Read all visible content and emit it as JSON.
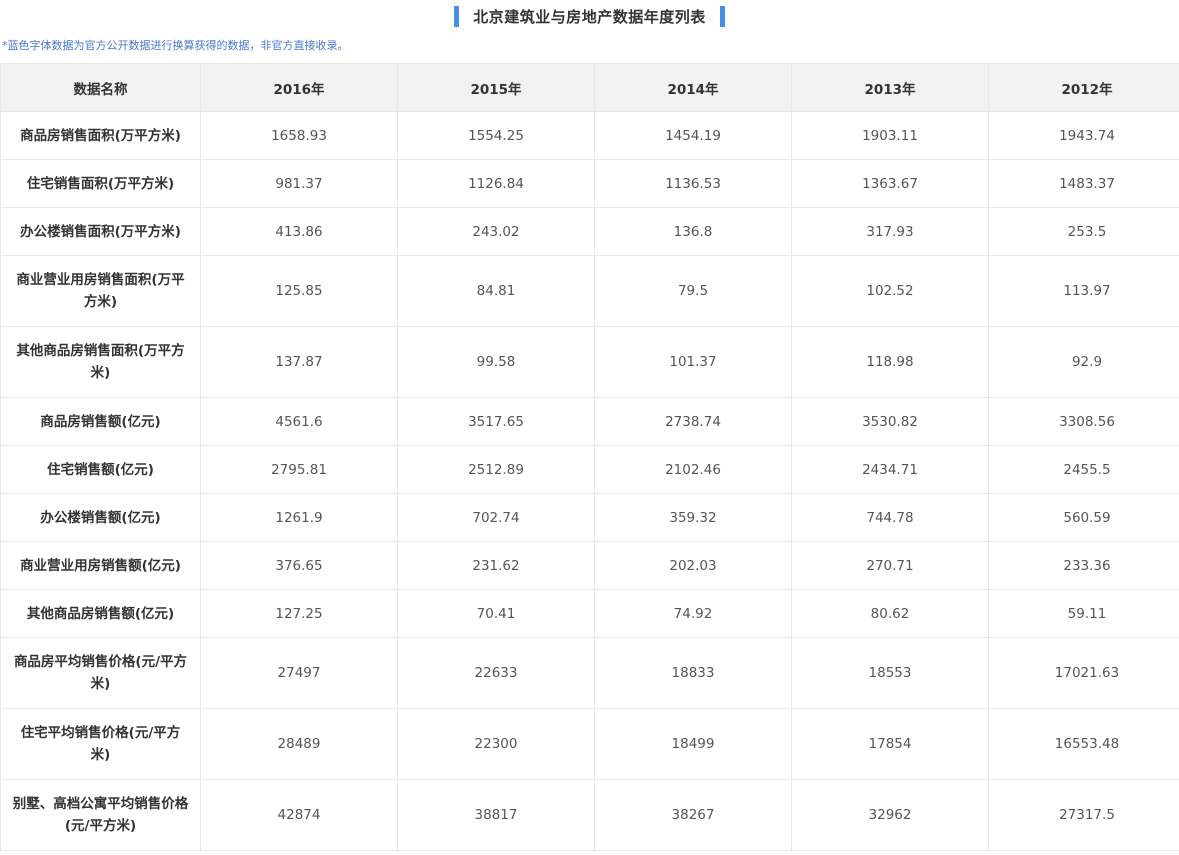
{
  "title": "北京建筑业与房地产数据年度列表",
  "note": "*蓝色字体数据为官方公开数据进行换算获得的数据，非官方直接收录。",
  "table": {
    "headers": [
      "数据名称",
      "2016年",
      "2015年",
      "2014年",
      "2013年",
      "2012年"
    ],
    "rows": [
      {
        "name": "商品房销售面积(万平方米)",
        "values": [
          "1658.93",
          "1554.25",
          "1454.19",
          "1903.11",
          "1943.74"
        ]
      },
      {
        "name": "住宅销售面积(万平方米)",
        "values": [
          "981.37",
          "1126.84",
          "1136.53",
          "1363.67",
          "1483.37"
        ]
      },
      {
        "name": "办公楼销售面积(万平方米)",
        "values": [
          "413.86",
          "243.02",
          "136.8",
          "317.93",
          "253.5"
        ]
      },
      {
        "name": "商业营业用房销售面积(万平方米)",
        "values": [
          "125.85",
          "84.81",
          "79.5",
          "102.52",
          "113.97"
        ]
      },
      {
        "name": "其他商品房销售面积(万平方米)",
        "values": [
          "137.87",
          "99.58",
          "101.37",
          "118.98",
          "92.9"
        ]
      },
      {
        "name": "商品房销售额(亿元)",
        "values": [
          "4561.6",
          "3517.65",
          "2738.74",
          "3530.82",
          "3308.56"
        ]
      },
      {
        "name": "住宅销售额(亿元)",
        "values": [
          "2795.81",
          "2512.89",
          "2102.46",
          "2434.71",
          "2455.5"
        ]
      },
      {
        "name": "办公楼销售额(亿元)",
        "values": [
          "1261.9",
          "702.74",
          "359.32",
          "744.78",
          "560.59"
        ]
      },
      {
        "name": "商业营业用房销售额(亿元)",
        "values": [
          "376.65",
          "231.62",
          "202.03",
          "270.71",
          "233.36"
        ]
      },
      {
        "name": "其他商品房销售额(亿元)",
        "values": [
          "127.25",
          "70.41",
          "74.92",
          "80.62",
          "59.11"
        ]
      },
      {
        "name": "商品房平均销售价格(元/平方米)",
        "values": [
          "27497",
          "22633",
          "18833",
          "18553",
          "17021.63"
        ]
      },
      {
        "name": "住宅平均销售价格(元/平方米)",
        "values": [
          "28489",
          "22300",
          "18499",
          "17854",
          "16553.48"
        ]
      },
      {
        "name": "别墅、高档公寓平均销售价格(元/平方米)",
        "values": [
          "42874",
          "38817",
          "38267",
          "32962",
          "27317.5"
        ]
      }
    ]
  },
  "colors": {
    "accent": "#4a90e2",
    "note_text": "#4a78c8",
    "header_bg": "#f2f2f2",
    "border": "#e8e8e8"
  }
}
